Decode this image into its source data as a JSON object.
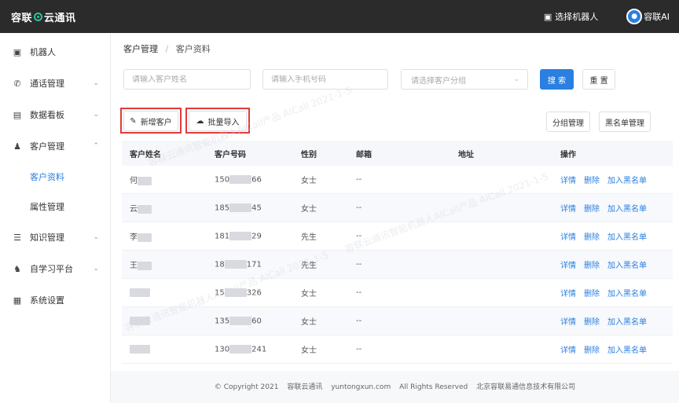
{
  "header": {
    "logo_text_1": "容联",
    "logo_text_2": "云通讯",
    "robot_select": "选择机器人",
    "user_name": "容联AI",
    "robot_icon": "robot-icon",
    "avatar_icon": "user-avatar-icon"
  },
  "sidebar": {
    "items": [
      {
        "label": "机器人",
        "icon": "robot-icon"
      },
      {
        "label": "通话管理",
        "icon": "phone-icon"
      },
      {
        "label": "数据看板",
        "icon": "dashboard-icon"
      },
      {
        "label": "客户管理",
        "icon": "users-icon"
      },
      {
        "label": "知识管理",
        "icon": "book-icon"
      },
      {
        "label": "自学习平台",
        "icon": "learn-icon"
      },
      {
        "label": "系统设置",
        "icon": "settings-icon"
      }
    ],
    "sub_items": [
      {
        "label": "客户资料"
      },
      {
        "label": "属性管理"
      }
    ]
  },
  "breadcrumb": {
    "parent": "客户管理",
    "separator": "/",
    "current": "客户资料"
  },
  "filters": {
    "name_placeholder": "请输入客户姓名",
    "phone_placeholder": "请输入手机号码",
    "group_placeholder": "请选择客户分组",
    "search_label": "搜 索",
    "reset_label": "重 置"
  },
  "toolbar": {
    "add_label": "新增客户",
    "import_label": "批量导入",
    "group_manage_label": "分组管理",
    "blacklist_manage_label": "黑名单管理"
  },
  "table": {
    "headers": [
      "客户姓名",
      "客户号码",
      "性别",
      "邮箱",
      "地址",
      "操作"
    ],
    "actions": [
      "详情",
      "删除",
      "加入黑名单"
    ],
    "rows": [
      {
        "name": "何",
        "phone_pre": "150",
        "phone_suf": "66",
        "gender": "女士",
        "email": "--"
      },
      {
        "name": "云",
        "phone_pre": "185",
        "phone_suf": "45",
        "gender": "女士",
        "email": "--"
      },
      {
        "name": "李",
        "phone_pre": "181",
        "phone_suf": "29",
        "gender": "先生",
        "email": "--"
      },
      {
        "name": "王",
        "phone_pre": "18",
        "phone_suf": "171",
        "gender": "先生",
        "email": "--"
      },
      {
        "name": "",
        "phone_pre": "15",
        "phone_suf": "326",
        "gender": "女士",
        "email": "--"
      },
      {
        "name": "",
        "phone_pre": "135",
        "phone_suf": "60",
        "gender": "女士",
        "email": "--"
      },
      {
        "name": "",
        "phone_pre": "130",
        "phone_suf": "241",
        "gender": "女士",
        "email": "--"
      }
    ]
  },
  "footer": {
    "copyright": "© Copyright 2021",
    "brand": "容联云通讯",
    "domain": "yuntongxun.com",
    "rights": "All Rights Reserved",
    "company": "北京容联易通信息技术有限公司"
  },
  "watermark": {
    "text": "容联云通讯智能机器人AICall产品 AICall 2021-1-5"
  },
  "colors": {
    "topbar": "#2b2b2b",
    "accent": "#2a7fe0",
    "highlight": "#e23a3a",
    "logo_ring": "#29c5a0"
  }
}
